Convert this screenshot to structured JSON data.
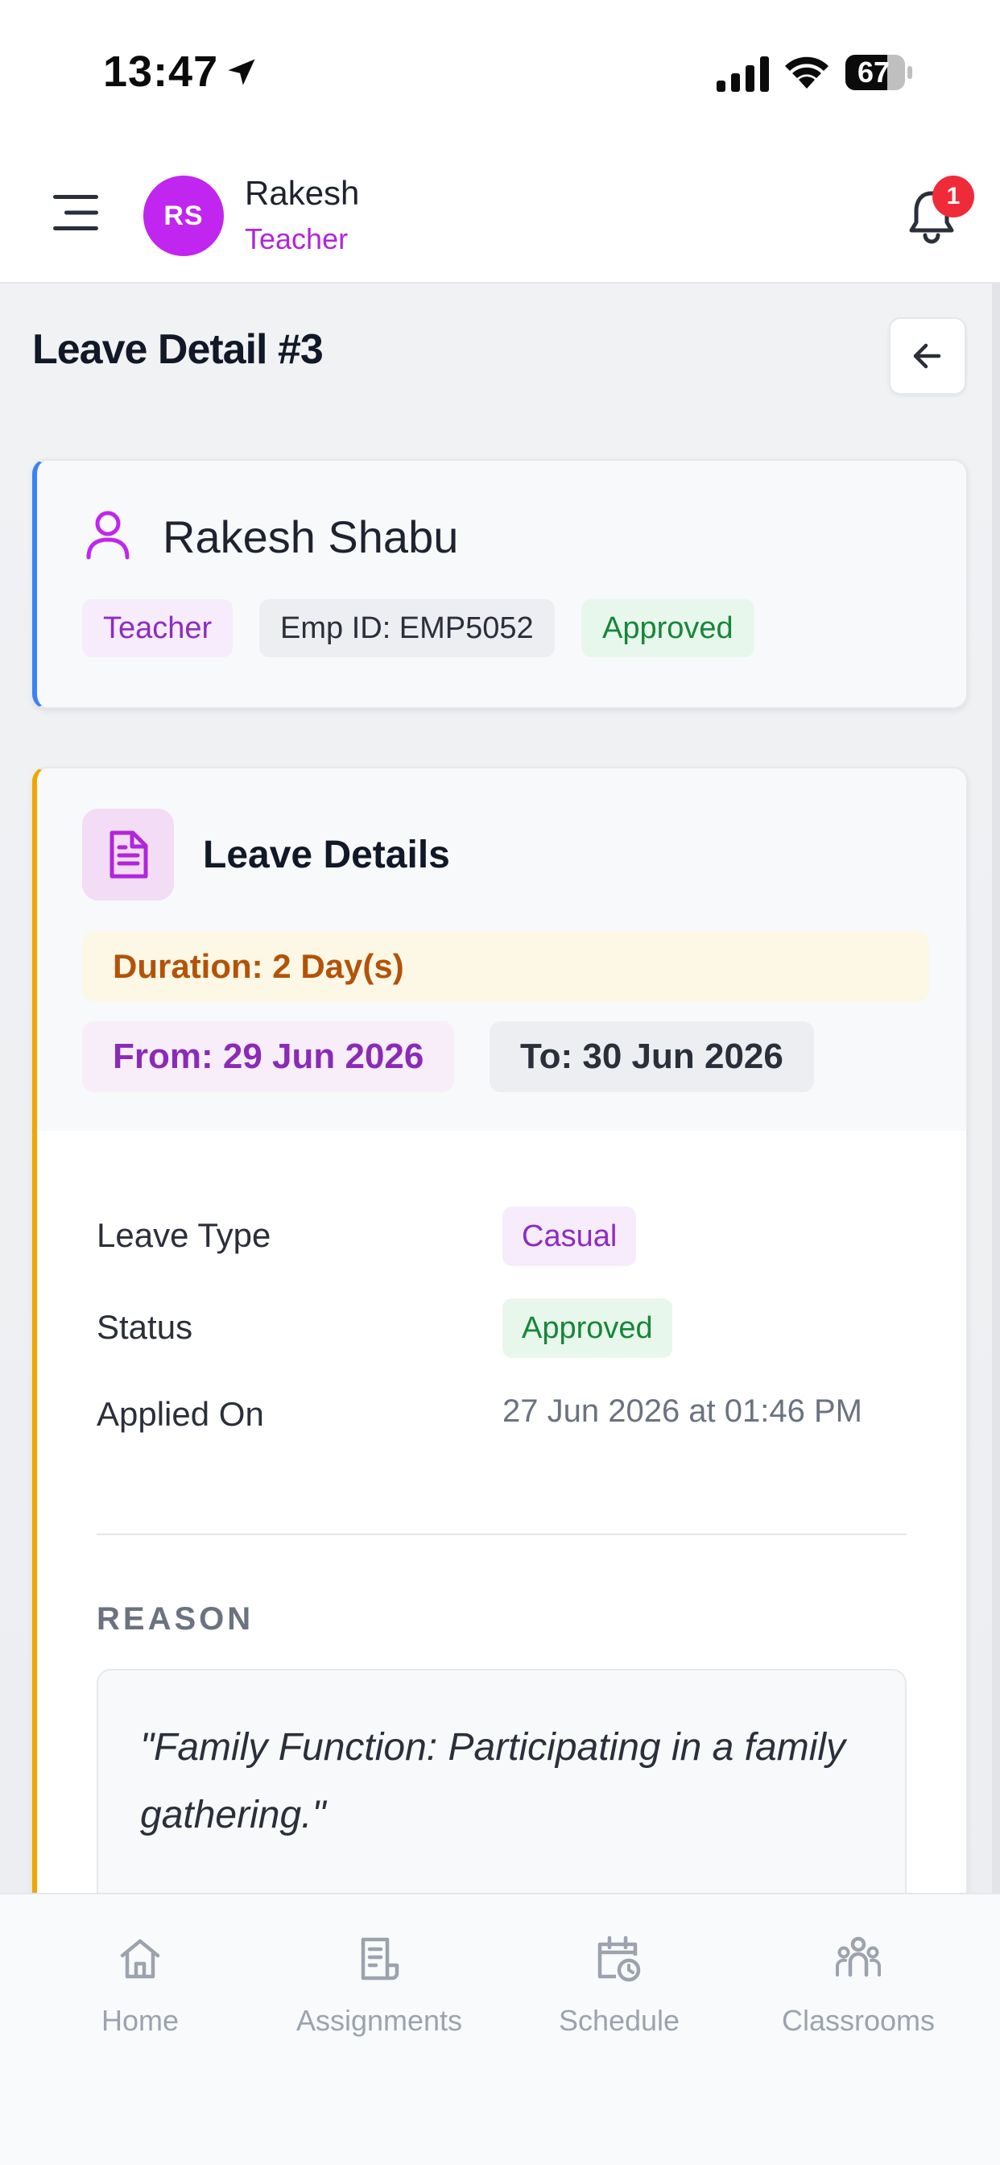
{
  "status_bar": {
    "time": "13:47",
    "battery": "67"
  },
  "header": {
    "avatar_initials": "RS",
    "user_name": "Rakesh",
    "user_role": "Teacher",
    "notification_count": "1"
  },
  "page": {
    "title": "Leave Detail #3"
  },
  "employee": {
    "name": "Rakesh Shabu",
    "role_chip": "Teacher",
    "emp_id_chip": "Emp ID: EMP5052",
    "status_chip": "Approved"
  },
  "leave": {
    "section_title": "Leave Details",
    "duration": "Duration: 2 Day(s)",
    "from": "From: 29 Jun 2026",
    "to": "To: 30 Jun 2026",
    "rows": [
      {
        "label": "Leave Type",
        "value": "Casual"
      },
      {
        "label": "Status",
        "value": "Approved"
      },
      {
        "label": "Applied On",
        "value": "27 Jun 2026 at 01:46 PM"
      }
    ],
    "reason_label": "REASON",
    "reason_text": "\"Family Function: Participating in a family gathering.\""
  },
  "bottom_nav": [
    {
      "label": "Home",
      "icon": "home-icon"
    },
    {
      "label": "Assignments",
      "icon": "assignments-icon"
    },
    {
      "label": "Schedule",
      "icon": "schedule-icon"
    },
    {
      "label": "Classrooms",
      "icon": "classrooms-icon"
    }
  ],
  "colors": {
    "accent_purple": "#c026f0",
    "emp_card_border": "#3b82f6",
    "leave_card_border": "#f0a500",
    "badge_red": "#ef2b3a"
  }
}
